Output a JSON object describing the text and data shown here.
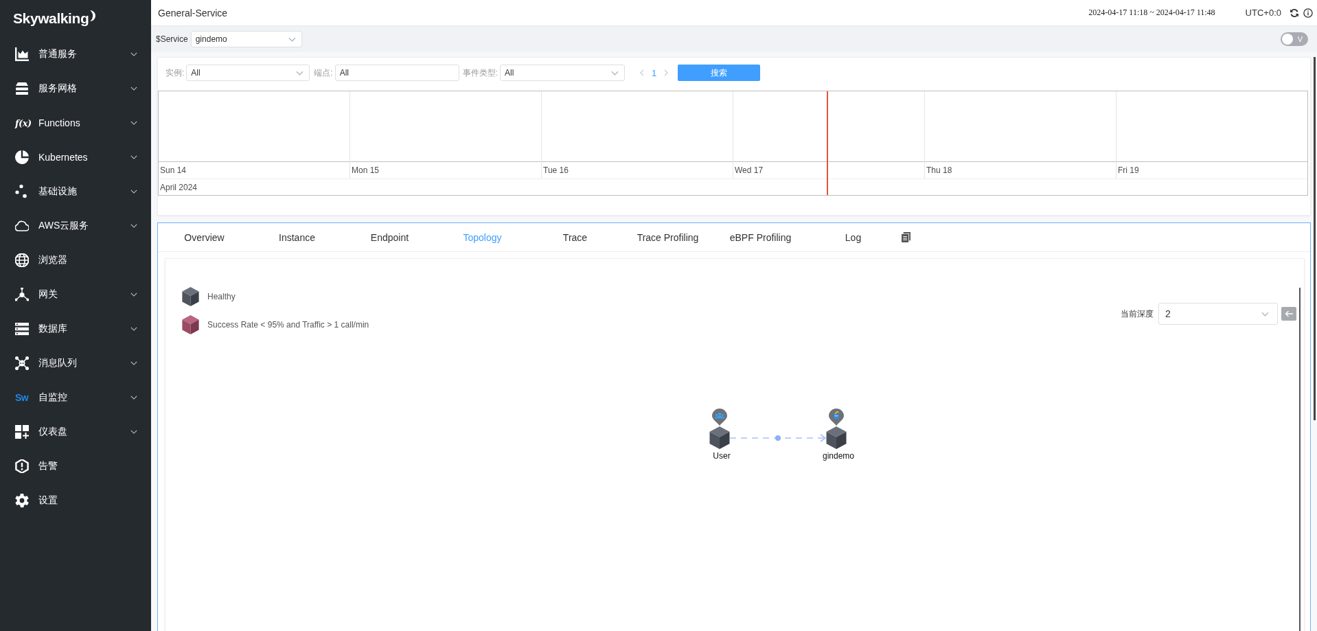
{
  "sidebar": {
    "logo": "Skywalking",
    "items": [
      {
        "label": "普通服务",
        "has_submenu": true
      },
      {
        "label": "服务网格",
        "has_submenu": true
      },
      {
        "label": "Functions",
        "icon_text": "f(x)",
        "has_submenu": true
      },
      {
        "label": "Kubernetes",
        "has_submenu": true
      },
      {
        "label": "基础设施",
        "has_submenu": true
      },
      {
        "label": "AWS云服务",
        "has_submenu": true
      },
      {
        "label": "浏览器",
        "has_submenu": false
      },
      {
        "label": "网关",
        "has_submenu": true
      },
      {
        "label": "数据库",
        "has_submenu": true
      },
      {
        "label": "消息队列",
        "has_submenu": true
      },
      {
        "label": "自监控",
        "icon_text": "Sw",
        "has_submenu": true
      },
      {
        "label": "仪表盘",
        "has_submenu": true
      },
      {
        "label": "告警",
        "has_submenu": false
      },
      {
        "label": "设置",
        "has_submenu": false
      }
    ]
  },
  "header": {
    "title": "General-Service",
    "time_range": "2024-04-17 11:18 ~ 2024-04-17 11:48",
    "timezone": "UTC+0:0"
  },
  "service_bar": {
    "label": "$Service",
    "value": "gindemo",
    "toggle": {
      "label": "V",
      "on": false
    }
  },
  "event_filters": {
    "fields": [
      {
        "label": "实例:",
        "kind": "select",
        "value": "All"
      },
      {
        "label": "端点:",
        "kind": "input",
        "value": "All"
      },
      {
        "label": "事件类型:",
        "kind": "select",
        "value": "All"
      }
    ],
    "pager": {
      "page": "1",
      "prev_disabled": true,
      "next_disabled": true
    },
    "search_button": "搜索"
  },
  "timeline": {
    "days": [
      {
        "label": "Sun 14",
        "current": false
      },
      {
        "label": "Mon 15",
        "current": false
      },
      {
        "label": "Tue 16",
        "current": false
      },
      {
        "label": "Wed 17",
        "current": true
      },
      {
        "label": "Thu 18",
        "current": false
      },
      {
        "label": "Fri 19",
        "current": false
      }
    ],
    "month": "April 2024"
  },
  "tabs": [
    {
      "label": "Overview",
      "selected": false
    },
    {
      "label": "Instance",
      "selected": false
    },
    {
      "label": "Endpoint",
      "selected": false
    },
    {
      "label": "Topology",
      "selected": true
    },
    {
      "label": "Trace",
      "selected": false
    },
    {
      "label": "Trace Profiling",
      "selected": false
    },
    {
      "label": "eBPF Profiling",
      "selected": false
    },
    {
      "label": "Log",
      "selected": false
    }
  ],
  "topology": {
    "legend": [
      {
        "label": "Healthy",
        "kind": "healthy"
      },
      {
        "label": "Success Rate < 95% and Traffic > 1 call/min",
        "kind": "unhealthy"
      }
    ],
    "depth": {
      "label": "当前深度",
      "value": "2"
    },
    "nodes": [
      {
        "label": "User",
        "kind": "user",
        "healthy": true,
        "calls_next": true
      },
      {
        "label": "gindemo",
        "kind": "service",
        "healthy": true,
        "calls_next": false
      }
    ]
  }
}
